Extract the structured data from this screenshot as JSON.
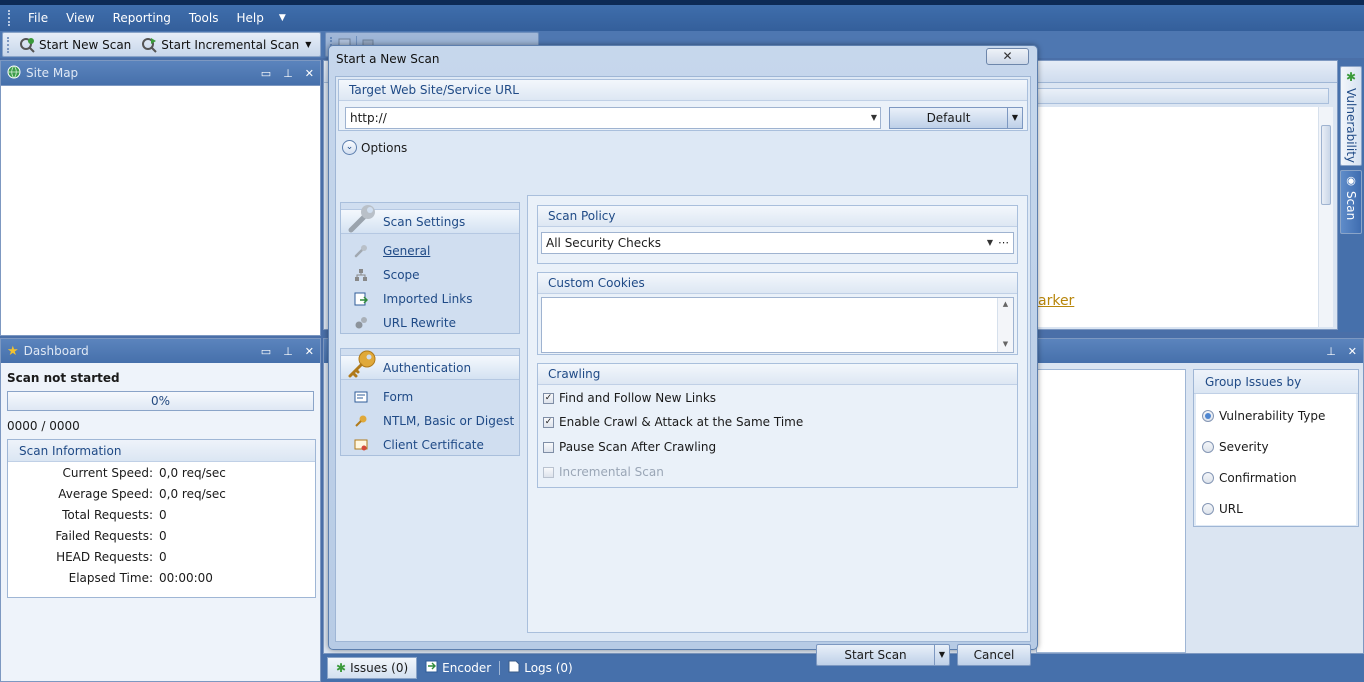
{
  "menubar": {
    "items": [
      "File",
      "View",
      "Reporting",
      "Tools",
      "Help"
    ]
  },
  "toolbar": {
    "new_scan": "Start New Scan",
    "incremental_scan": "Start Incremental Scan"
  },
  "sitemap": {
    "title": "Site Map"
  },
  "dashboard": {
    "title": "Dashboard",
    "status": "Scan not started",
    "progress_label": "0%",
    "progress_value": 0,
    "counter": "0000 / 0000",
    "info_title": "Scan Information",
    "rows": [
      {
        "k": "Current Speed:",
        "v": "0,0 req/sec"
      },
      {
        "k": "Average Speed:",
        "v": "0,0 req/sec"
      },
      {
        "k": "Total Requests:",
        "v": "0"
      },
      {
        "k": "Failed Requests:",
        "v": "0"
      },
      {
        "k": "HEAD Requests:",
        "v": "0"
      },
      {
        "k": "Elapsed Time:",
        "v": "00:00:00"
      }
    ]
  },
  "main": {
    "link_fragment": "arker"
  },
  "vtabs": {
    "vulnerability": "Vulnerability",
    "scan": "Scan"
  },
  "group_issues": {
    "title": "Group Issues by",
    "options": [
      {
        "label": "Vulnerability Type",
        "selected": true
      },
      {
        "label": "Severity",
        "selected": false
      },
      {
        "label": "Confirmation",
        "selected": false
      },
      {
        "label": "URL",
        "selected": false
      }
    ]
  },
  "bottom_tabs": [
    "Issues (0)",
    "Encoder",
    "Logs (0)"
  ],
  "dialog": {
    "title": "Start a New Scan",
    "close": "✕",
    "target_group": "Target Web Site/Service URL",
    "url_value": "http://",
    "profile_button": "Default",
    "options_label": "Options",
    "nav_scan_title": "Scan Settings",
    "nav_scan_items": [
      "General",
      "Scope",
      "Imported Links",
      "URL Rewrite"
    ],
    "nav_auth_title": "Authentication",
    "nav_auth_items": [
      "Form",
      "NTLM, Basic or Digest",
      "Client Certificate"
    ],
    "policy_title": "Scan Policy",
    "policy_value": "All Security Checks",
    "cookies_title": "Custom Cookies",
    "crawling_title": "Crawling",
    "crawl_options": [
      {
        "label": "Find and Follow New Links",
        "checked": true,
        "enabled": true
      },
      {
        "label": "Enable Crawl & Attack at the Same Time",
        "checked": true,
        "enabled": true
      },
      {
        "label": "Pause Scan After Crawling",
        "checked": false,
        "enabled": true
      },
      {
        "label": "Incremental Scan",
        "checked": false,
        "enabled": false
      }
    ],
    "start_button": "Start Scan",
    "cancel_button": "Cancel"
  }
}
